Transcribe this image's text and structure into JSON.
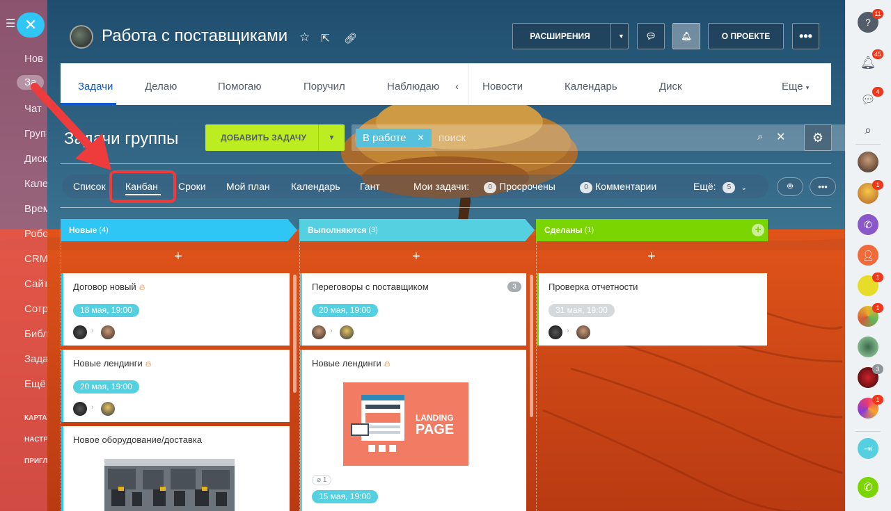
{
  "left_nav": {
    "items": [
      "Нов",
      "За",
      "Чат",
      "Груп",
      "Диск",
      "Кале",
      "Врем",
      "Робо",
      "CRM",
      "Сайт",
      "Сотр",
      "Библ",
      "Зада",
      "Ещё"
    ],
    "sections": [
      "КАРТА",
      "НАСТР",
      "ПРИГЛ"
    ]
  },
  "header": {
    "title": "Работа с поставщиками",
    "extensions_label": "РАСШИРЕНИЯ",
    "about_label": "О ПРОЕКТЕ"
  },
  "tabs": {
    "items": [
      "Задачи",
      "Делаю",
      "Помогаю",
      "Поручил",
      "Наблюдаю",
      "Новости",
      "Календарь",
      "Диск"
    ],
    "more_label": "Еще",
    "active": "Задачи"
  },
  "toolbar": {
    "group_title": "Задачи группы",
    "add_task_label": "ДОБАВИТЬ ЗАДАЧУ",
    "filter_chip": "В работе",
    "search_placeholder": "поиск"
  },
  "views": {
    "list": "Список",
    "kanban": "Канбан",
    "deadlines": "Сроки",
    "my_plan": "Мой план",
    "calendar": "Календарь",
    "gantt": "Гант",
    "my_tasks_label": "Мои задачи:",
    "overdue_count": "0",
    "overdue_label": "Просрочены",
    "comments_count": "0",
    "comments_label": "Комментарии",
    "more_label": "Ещё:",
    "more_count": "5"
  },
  "columns": [
    {
      "title": "Новые",
      "count": "(4)",
      "color": "#2fc6f6"
    },
    {
      "title": "Выполняются",
      "count": "(3)",
      "color": "#55d0e0"
    },
    {
      "title": "Сделаны",
      "count": "(1)",
      "color": "#7bd500"
    }
  ],
  "cards": {
    "c1": {
      "title": "Договор новый",
      "date": "18 мая, 19:00"
    },
    "c2": {
      "title": "Новые лендинги",
      "date": "20 мая, 19:00"
    },
    "c3": {
      "title": "Новое оборудование/доставка"
    },
    "c4": {
      "title": "Переговоры с поставщиком",
      "date": "20 мая, 19:00",
      "comments": "3"
    },
    "c5": {
      "title": "Новые лендинги",
      "landing_line1": "LANDING",
      "landing_line2": "PAGE",
      "attachments": "1",
      "date": "15 мая, 19:00"
    },
    "c6": {
      "title": "Проверка отчетности",
      "date": "31 мая, 19:00"
    }
  },
  "right_bar": {
    "help_badge": "11",
    "notif_badge": "45",
    "chat_badge": "4",
    "badges": [
      "1",
      "1",
      "1",
      "3",
      "1"
    ]
  }
}
